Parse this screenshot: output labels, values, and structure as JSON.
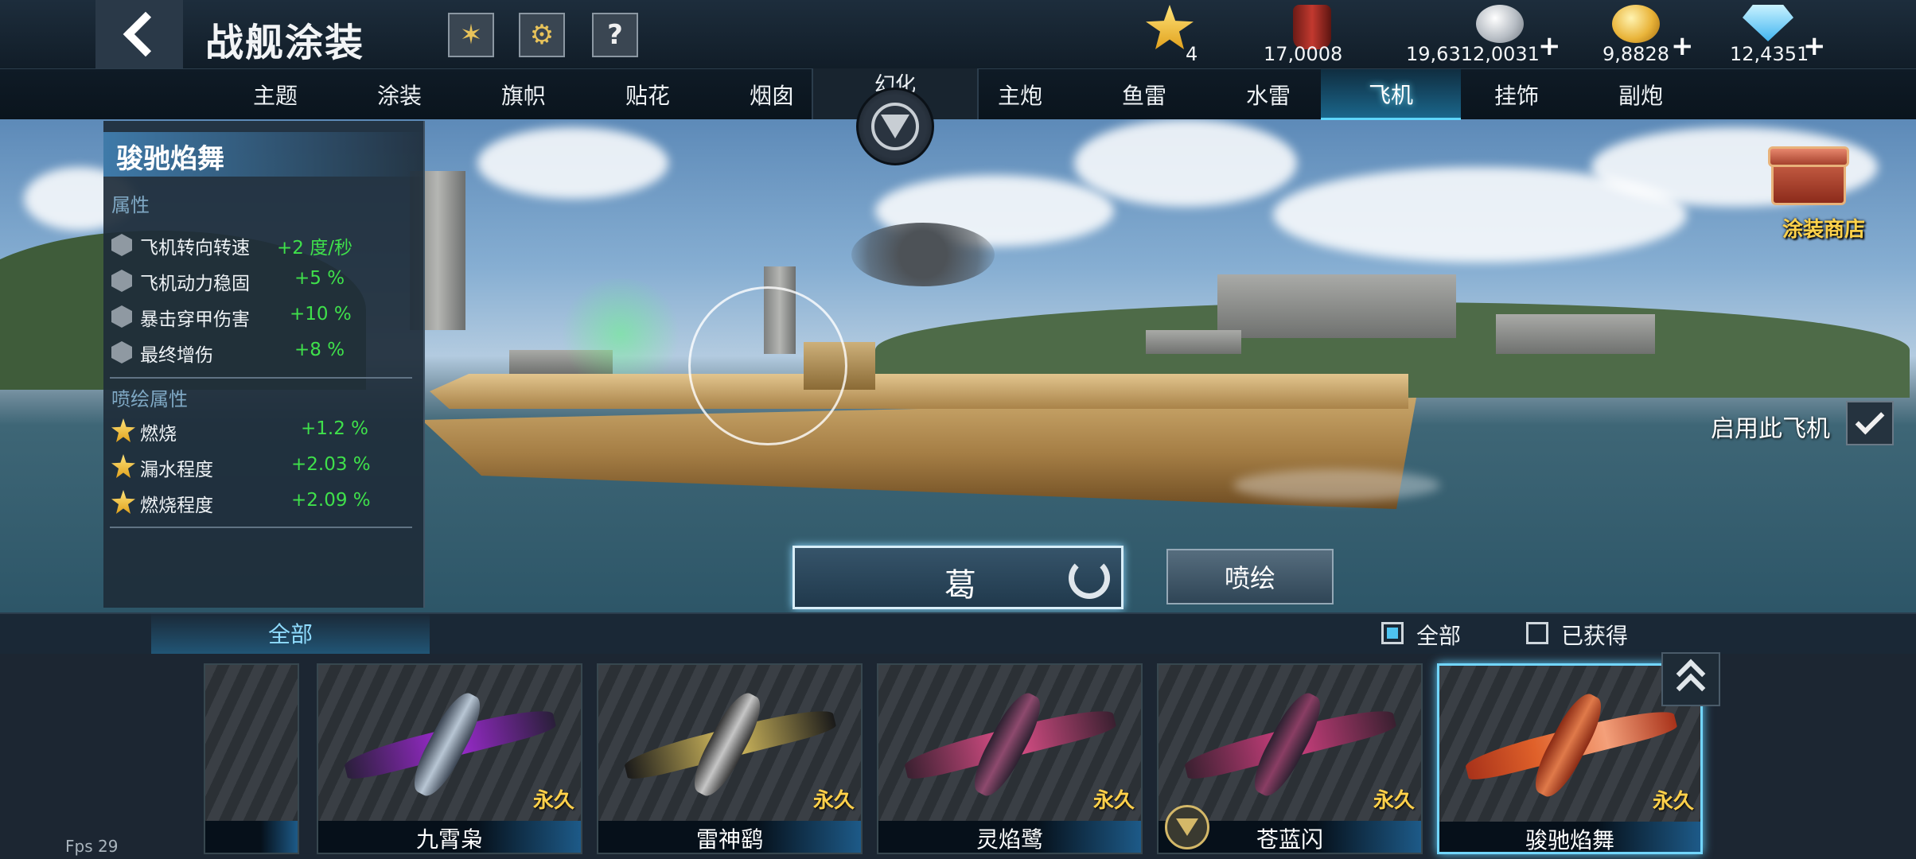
{
  "header": {
    "title": "战舰涂装",
    "resources": [
      {
        "icon": "star-icon",
        "value": "4",
        "plus": false
      },
      {
        "icon": "paint-bucket-icon",
        "value": "17,0008",
        "plus": false
      },
      {
        "icon": "silver-coin-icon",
        "value": "19,6312,0031",
        "plus": true
      },
      {
        "icon": "gold-coin-icon",
        "value": "9,8828",
        "plus": true
      },
      {
        "icon": "diamond-icon",
        "value": "12,4351",
        "plus": true
      }
    ],
    "plus_symbol": "+",
    "help_symbol": "?"
  },
  "tabs": {
    "items": [
      "主题",
      "涂装",
      "旗帜",
      "贴花",
      "烟囱",
      "主炮",
      "鱼雷",
      "水雷",
      "飞机",
      "挂饰",
      "副炮"
    ],
    "center_label": "幻化",
    "active": "飞机"
  },
  "attributes": {
    "title": "骏驰焰舞",
    "section_props": "属性",
    "props": [
      {
        "name": "飞机转向转速",
        "value": "+2 度/秒"
      },
      {
        "name": "飞机动力稳固",
        "value": "+5 %"
      },
      {
        "name": "暴击穿甲伤害",
        "value": "+10 %"
      },
      {
        "name": "最终增伤",
        "value": "+8 %"
      }
    ],
    "section_spray": "喷绘属性",
    "spray": [
      {
        "name": "燃烧",
        "value": "+1.2 %"
      },
      {
        "name": "漏水程度",
        "value": "+2.03 %"
      },
      {
        "name": "燃烧程度",
        "value": "+2.09 %"
      }
    ]
  },
  "side": {
    "shop_label": "涂装商店",
    "enable_label": "启用此飞机",
    "enabled": true
  },
  "actions": {
    "name_button": "葛",
    "paint_button": "喷绘"
  },
  "filter": {
    "tab_all": "全部",
    "check_all": "全部",
    "check_owned": "已获得",
    "all_checked": true,
    "owned_checked": false
  },
  "cards": [
    {
      "name": "九霄枭",
      "perm": "永久",
      "accent": "#a12bd6"
    },
    {
      "name": "雷神鹞",
      "perm": "永久",
      "accent": "#d9c060"
    },
    {
      "name": "灵焰鹭",
      "perm": "永久",
      "accent": "#e0508a"
    },
    {
      "name": "苍蓝闪",
      "perm": "永久",
      "accent": "#d04080"
    },
    {
      "name": "骏驰焰舞",
      "perm": "永久",
      "accent": "#e0612a"
    }
  ],
  "status": {
    "fps": "Fps 29"
  }
}
